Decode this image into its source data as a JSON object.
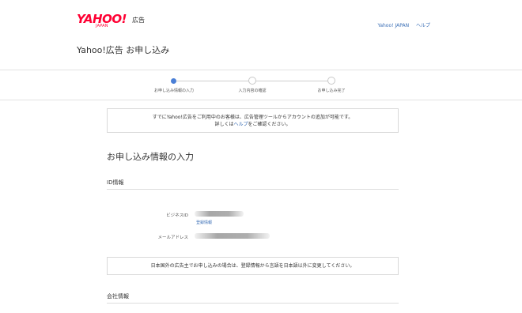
{
  "header": {
    "logo_text": "YAHOO!",
    "logo_sub": "広告",
    "logo_japan": "JAPAN",
    "links": [
      "Yahoo! JAPAN",
      "ヘルプ"
    ],
    "page_title": "Yahoo!広告 お申し込み"
  },
  "steps": {
    "items": [
      {
        "label": "お申し込み情報の入力",
        "state": "active"
      },
      {
        "label": "入力内容の確認",
        "state": "inactive"
      },
      {
        "label": "お申し込み完了",
        "state": "inactive"
      }
    ],
    "progress": 0
  },
  "notice_top": {
    "line1": "すでにYahoo!広告をご利用中のお客様は、広告管理ツールからアカウントの追加が可能です。",
    "line2_pre": "詳しくは",
    "line2_link": "ヘルプ",
    "line2_post": "をご確認ください。"
  },
  "section": {
    "title": "お申し込み情報の入力",
    "id_info": {
      "heading": "ID情報",
      "business_id_label": "ビジネスID",
      "registration_link": "登録情報",
      "email_label": "メールアドレス"
    }
  },
  "notice_bottom": {
    "text": "日本国外の広告主でお申し込みの場合は、登録情報から言語を日本語以外に変更してください。"
  },
  "company_info": {
    "heading": "会社情報"
  },
  "colors": {
    "brand": "#ff0033",
    "link": "#3b6fb6",
    "active_step": "#4a7fd6"
  }
}
